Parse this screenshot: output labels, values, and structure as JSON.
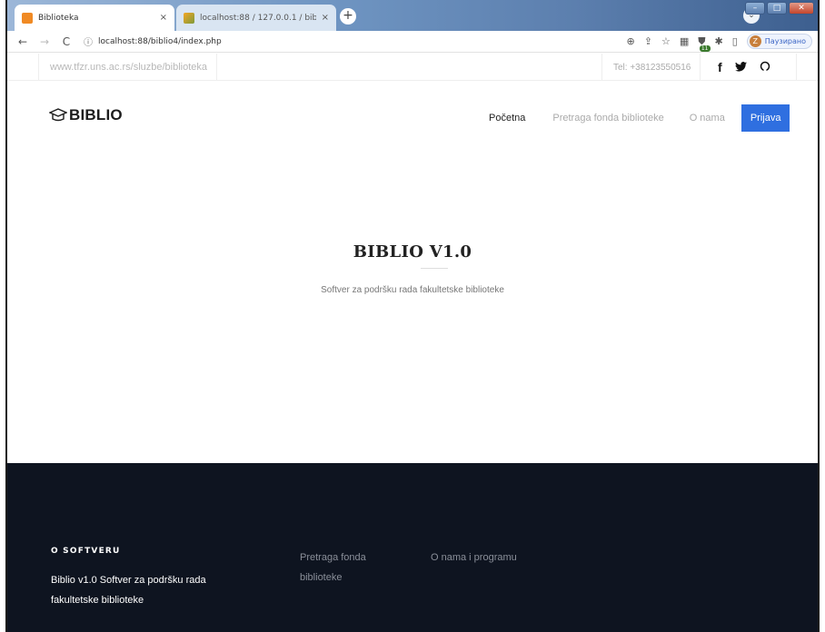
{
  "browser": {
    "tabs": [
      {
        "title": "Biblioteka",
        "close": "×"
      },
      {
        "title": "localhost:88 / 127.0.0.1 / biblio /",
        "close": "×"
      }
    ],
    "new_tab": "+",
    "url": "localhost:88/biblio4/index.php",
    "profile_chip": "Паузирано",
    "profile_initial": "Z",
    "extension_badge": "11"
  },
  "topbar": {
    "site": "www.tfzr.uns.ac.rs/sluzbe/biblioteka",
    "tel": "Tel: +38123550516",
    "social": [
      "facebook-icon",
      "twitter-icon",
      "github-icon"
    ]
  },
  "header": {
    "logo_text": "BIBLIO",
    "menu": {
      "home": "Početna",
      "search": "Pretraga fonda biblioteke",
      "about": "O nama",
      "login": "Prijava"
    }
  },
  "hero": {
    "title": "BIBLIO V1.0",
    "subtitle": "Softver za podršku rada fakultetske biblioteke"
  },
  "footer": {
    "heading": "O SOFTVERU",
    "description": "Biblio v1.0 Softver za podršku rada fakultetske biblioteke",
    "link_search": "Pretraga fonda biblioteke",
    "link_about": "O nama i programu"
  },
  "colors": {
    "accent": "#2f6fe0",
    "footer_bg": "#0e1420"
  }
}
